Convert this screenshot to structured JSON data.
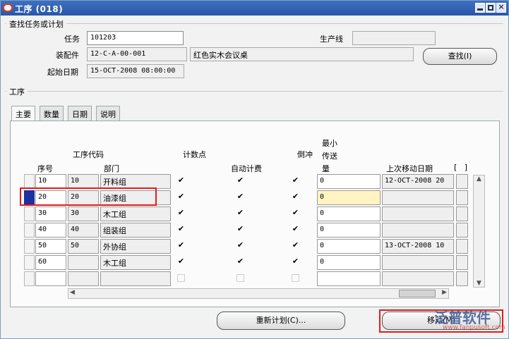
{
  "window": {
    "title": "工序 (018)"
  },
  "search": {
    "section_label": "查找任务或计划",
    "task_label": "任务",
    "task_value": "101203",
    "line_label": "生产线",
    "line_value": "",
    "assembly_label": "装配件",
    "assembly_value": "12-C-A-00-001",
    "assembly_desc": "红色实木会议桌",
    "start_label": "起始日期",
    "start_value": "15-OCT-2008 08:00:00",
    "find_button": "查找(I)"
  },
  "ops": {
    "section_label": "工序",
    "tabs": [
      "主要",
      "数量",
      "日期",
      "说明"
    ],
    "headers": {
      "seq": "序号",
      "opcode": "工序代码",
      "dept": "部门",
      "count_point": "计数点",
      "auto_charge": "自动计费",
      "backflush": "倒冲",
      "min_transfer_1": "最小",
      "min_transfer_2": "传送",
      "min_transfer_3": "量",
      "last_move": "上次移动日期",
      "brackets": "[   ]"
    },
    "rows": [
      {
        "seq": "10",
        "code": "10",
        "dept": "开料组",
        "count": true,
        "auto": true,
        "back": true,
        "min": "0",
        "date": "12-OCT-2008 20"
      },
      {
        "seq": "20",
        "code": "20",
        "dept": "油漆组",
        "count": true,
        "auto": true,
        "back": true,
        "min": "0",
        "date": ""
      },
      {
        "seq": "30",
        "code": "30",
        "dept": "木工组",
        "count": true,
        "auto": true,
        "back": true,
        "min": "0",
        "date": ""
      },
      {
        "seq": "40",
        "code": "40",
        "dept": "组装组",
        "count": true,
        "auto": true,
        "back": true,
        "min": "0",
        "date": ""
      },
      {
        "seq": "50",
        "code": "50",
        "dept": "外协组",
        "count": true,
        "auto": true,
        "back": true,
        "min": "0",
        "date": "13-OCT-2008 10"
      },
      {
        "seq": "60",
        "code": "",
        "dept": "木工组",
        "count": true,
        "auto": true,
        "back": true,
        "min": "0",
        "date": ""
      },
      {
        "seq": "",
        "code": "",
        "dept": "",
        "count": false,
        "auto": false,
        "back": false,
        "min": "",
        "date": ""
      }
    ]
  },
  "footer": {
    "reschedule_button": "重新计划(C)...",
    "move_button": "移动(M)",
    "watermark": "泛普软件",
    "watermark_url": "www.fanpusoft.com"
  },
  "colors": {
    "title_bar": "#2a56a8",
    "selected_row": "#1f2f9e",
    "highlight": "#e21b1b",
    "current_cell": "#fff4c2"
  }
}
